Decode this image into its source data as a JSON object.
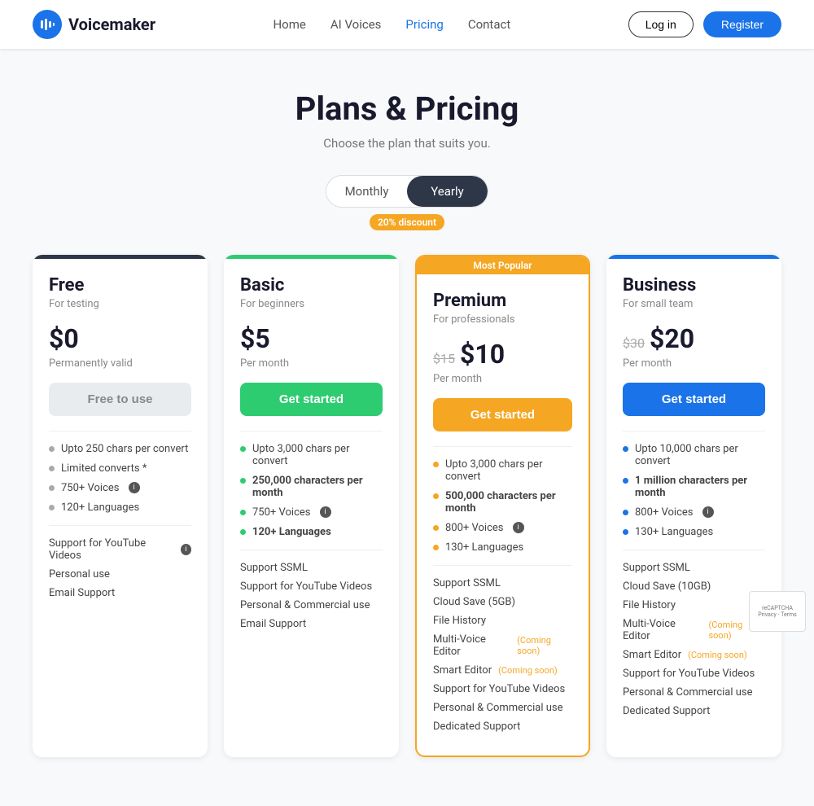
{
  "header": {
    "logo_text": "Voicemaker",
    "nav": [
      {
        "label": "Home",
        "active": false
      },
      {
        "label": "AI Voices",
        "active": false
      },
      {
        "label": "Pricing",
        "active": true
      },
      {
        "label": "Contact",
        "active": false
      }
    ],
    "login_label": "Log in",
    "register_label": "Register"
  },
  "hero": {
    "title": "Plans & Pricing",
    "subtitle": "Choose the plan that suits you."
  },
  "toggle": {
    "monthly_label": "Monthly",
    "yearly_label": "Yearly",
    "discount_label": "20% discount"
  },
  "plans": [
    {
      "id": "free",
      "name": "Free",
      "desc": "For testing",
      "price": "$0",
      "price_original": null,
      "period": "Permanently valid",
      "btn_label": "Free to use",
      "popular": false,
      "dot_class": "dot-gray",
      "features": [
        {
          "text": "Upto 250 chars per convert",
          "bold": false
        },
        {
          "text": "Limited converts *",
          "bold": false
        },
        {
          "text": "750+ Voices",
          "bold": false,
          "info": true
        },
        {
          "text": "120+ Languages",
          "bold": false
        }
      ],
      "extras": [
        {
          "text": "Support for YouTube Videos",
          "info": true
        },
        {
          "text": "Personal use"
        },
        {
          "text": "Email Support"
        }
      ]
    },
    {
      "id": "basic",
      "name": "Basic",
      "desc": "For beginners",
      "price": "$5",
      "price_original": null,
      "period": "Per month",
      "btn_label": "Get started",
      "popular": false,
      "dot_class": "dot-green",
      "features": [
        {
          "text": "Upto 3,000 chars per convert",
          "bold": false
        },
        {
          "text": "250,000 characters per month",
          "bold": true
        },
        {
          "text": "750+ Voices",
          "bold": false,
          "info": true
        },
        {
          "text": "120+ Languages",
          "bold": false
        }
      ],
      "extras": [
        {
          "text": "Support SSML"
        },
        {
          "text": "Support for YouTube Videos"
        },
        {
          "text": "Personal & Commercial use"
        },
        {
          "text": "Email Support"
        }
      ]
    },
    {
      "id": "premium",
      "name": "Premium",
      "desc": "For professionals",
      "price": "$10",
      "price_original": "$15",
      "period": "Per month",
      "btn_label": "Get started",
      "popular": true,
      "popular_label": "Most Popular",
      "dot_class": "dot-orange",
      "features": [
        {
          "text": "Upto 3,000 chars per convert",
          "bold": false
        },
        {
          "text": "500,000 characters per month",
          "bold": true
        },
        {
          "text": "800+ Voices",
          "bold": false,
          "info": true
        },
        {
          "text": "130+ Languages",
          "bold": false
        }
      ],
      "extras": [
        {
          "text": "Support SSML"
        },
        {
          "text": "Cloud Save (5GB)"
        },
        {
          "text": "File History"
        },
        {
          "text": "Multi-Voice Editor",
          "coming": "Coming soon"
        },
        {
          "text": "Smart Editor",
          "coming": "Coming soon"
        },
        {
          "text": "Support for YouTube Videos"
        },
        {
          "text": "Personal & Commercial use"
        },
        {
          "text": "Dedicated Support"
        }
      ]
    },
    {
      "id": "business",
      "name": "Business",
      "desc": "For small team",
      "price": "$20",
      "price_original": "$30",
      "period": "Per month",
      "btn_label": "Get started",
      "popular": false,
      "dot_class": "dot-blue",
      "features": [
        {
          "text": "Upto 10,000 chars per convert",
          "bold": false
        },
        {
          "text": "1 million characters per month",
          "bold": true
        },
        {
          "text": "800+ Voices",
          "bold": false,
          "info": true
        },
        {
          "text": "130+ Languages",
          "bold": false
        }
      ],
      "extras": [
        {
          "text": "Support SSML"
        },
        {
          "text": "Cloud Save (10GB)"
        },
        {
          "text": "File History"
        },
        {
          "text": "Multi-Voice Editor",
          "coming": "Coming soon"
        },
        {
          "text": "Smart Editor",
          "coming": "Coming soon"
        },
        {
          "text": "Support for YouTube Videos"
        },
        {
          "text": "Personal & Commercial use"
        },
        {
          "text": "Dedicated Support"
        }
      ]
    }
  ]
}
